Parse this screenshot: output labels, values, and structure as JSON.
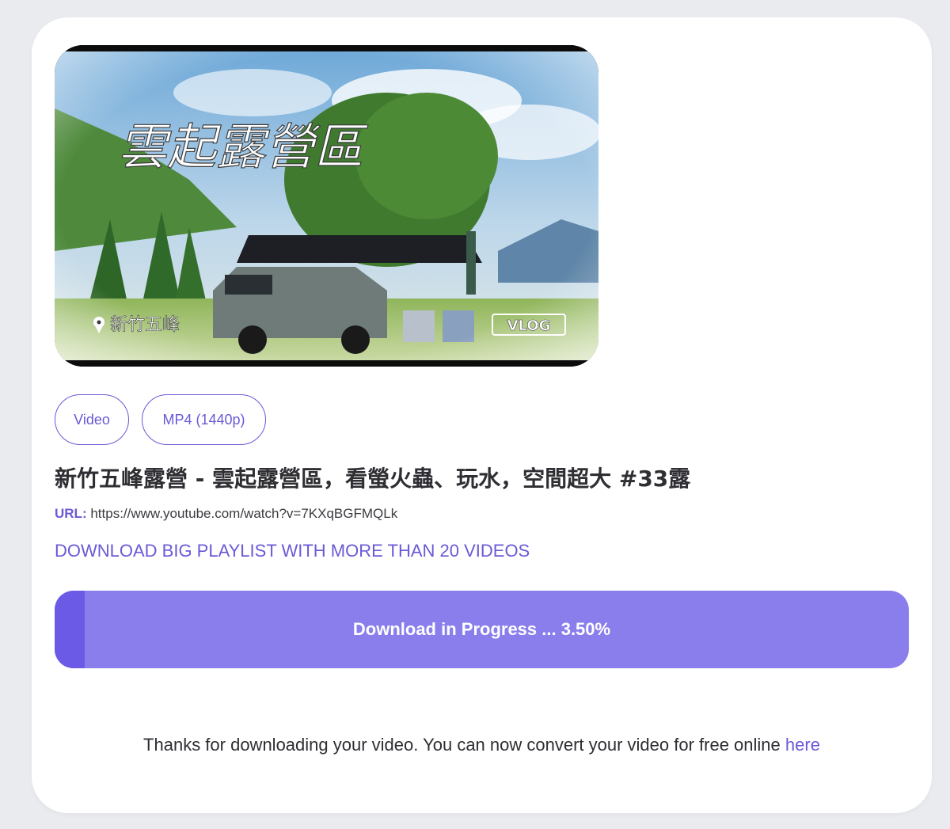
{
  "thumbnail": {
    "overlay_title": "雲起露營區",
    "location_text": "新竹五峰",
    "badge": "VLOG"
  },
  "chips": {
    "type": "Video",
    "format": "MP4 (1440p)"
  },
  "video": {
    "title": "新竹五峰露營 - 雲起露營區，看螢火蟲、玩水，空間超大 #33露",
    "url_label": "URL:",
    "url": "https://www.youtube.com/watch?v=7KXqBGFMQLk"
  },
  "playlist_link": "DOWNLOAD BIG PLAYLIST WITH MORE THAN 20 VIDEOS",
  "progress": {
    "label": "Download in Progress ... 3.50%",
    "percent": 3.5
  },
  "thanks": {
    "text": "Thanks for downloading your video. You can now convert your video for free online",
    "link": "here"
  },
  "colors": {
    "accent": "#6a5ad6",
    "progress_bg": "#8a7eed",
    "progress_fill": "#6a5ae6"
  }
}
